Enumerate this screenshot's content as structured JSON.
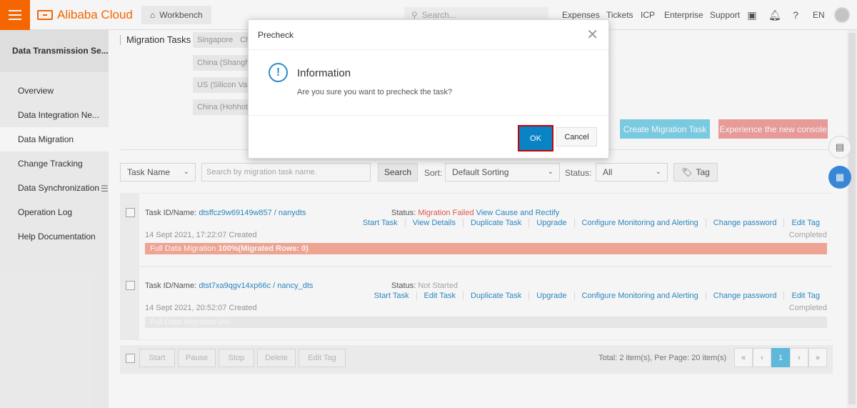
{
  "topbar": {
    "brand": "Alibaba Cloud",
    "workbench": "Workbench",
    "search_placeholder": "Search...",
    "nav": [
      "Expenses",
      "Tickets",
      "ICP",
      "Enterprise",
      "Support"
    ],
    "lang": "EN"
  },
  "sidebar": {
    "title": "Data Transmission Se...",
    "items": [
      {
        "label": "Overview"
      },
      {
        "label": "Data Integration  Ne..."
      },
      {
        "label": "Data Migration"
      },
      {
        "label": "Change Tracking"
      },
      {
        "label": "Data Synchronization"
      },
      {
        "label": "Operation Log"
      },
      {
        "label": "Help Documentation"
      }
    ]
  },
  "main": {
    "section_label": "Migration Tasks",
    "regions": [
      "Singapore",
      "Ch",
      "China (Shangha",
      "US (Silicon Valle",
      "China (Hohhot)"
    ],
    "create_button": "Create Migration Task",
    "new_console_button": "Experience the new console"
  },
  "filters": {
    "field_select": "Task Name",
    "search_placeholder": "Search by migration task name.",
    "search_button": "Search",
    "sort_label": "Sort:",
    "sort_value": "Default Sorting",
    "status_label": "Status:",
    "status_value": "All",
    "tag_button": "Tag"
  },
  "tasks": [
    {
      "id_label": "Task ID/Name:",
      "id_value": "dtsffcz9w69149w857 / nanydts",
      "status_label": "Status:",
      "status_value": "Migration Failed",
      "status_link": "View Cause and Rectify",
      "actions": [
        "Start Task",
        "View Details",
        "Duplicate Task",
        "Upgrade",
        "Configure Monitoring and Alerting",
        "Change password",
        "Edit Tag"
      ],
      "created": "14 Sept 2021, 17:22:07  Created",
      "completion": "Completed",
      "progress_label": "Full Data Migration",
      "progress_value": "100%(Migrated Rows: 0)",
      "progress_percent": 100
    },
    {
      "id_label": "Task ID/Name:",
      "id_value": "dtst7xa9qgv14xp66c / nancy_dts",
      "status_label": "Status:",
      "status_value": "Not Started",
      "status_link": "",
      "actions": [
        "Start Task",
        "Edit Task",
        "Duplicate Task",
        "Upgrade",
        "Configure Monitoring and Alerting",
        "Change password",
        "Edit Tag"
      ],
      "created": "14 Sept 2021, 20:52:07  Created",
      "completion": "Completed",
      "progress_label": "Full Data Migration",
      "progress_value": "0%",
      "progress_percent": 0
    }
  ],
  "bulk": {
    "buttons": [
      "Start",
      "Pause",
      "Stop",
      "Delete",
      "Edit Tag"
    ],
    "total": "Total: 2 item(s),   Per Page: 20 item(s)",
    "pages": [
      "«",
      "‹",
      "1",
      "›",
      "»"
    ]
  },
  "modal": {
    "title": "Precheck",
    "info_title": "Information",
    "message": "Are you sure you want to precheck the task?",
    "ok": "OK",
    "cancel": "Cancel"
  }
}
